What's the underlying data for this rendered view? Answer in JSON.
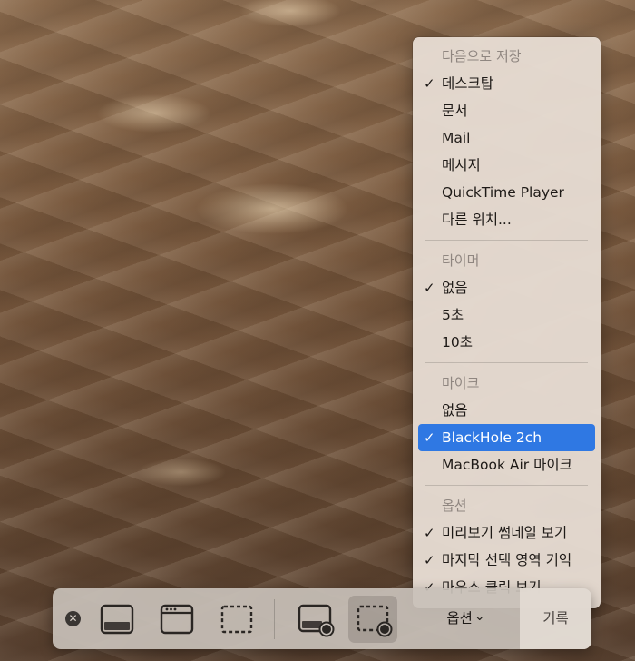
{
  "menu": {
    "save_to": {
      "header": "다음으로 저장",
      "items": [
        {
          "label": "데스크탑",
          "checked": true
        },
        {
          "label": "문서",
          "checked": false
        },
        {
          "label": "Mail",
          "checked": false
        },
        {
          "label": "메시지",
          "checked": false
        },
        {
          "label": "QuickTime Player",
          "checked": false
        },
        {
          "label": "다른 위치...",
          "checked": false
        }
      ]
    },
    "timer": {
      "header": "타이머",
      "items": [
        {
          "label": "없음",
          "checked": true
        },
        {
          "label": "5초",
          "checked": false
        },
        {
          "label": "10초",
          "checked": false
        }
      ]
    },
    "microphone": {
      "header": "마이크",
      "items": [
        {
          "label": "없음",
          "checked": false
        },
        {
          "label": "BlackHole 2ch",
          "checked": true,
          "highlighted": true
        },
        {
          "label": "MacBook Air 마이크",
          "checked": false
        }
      ]
    },
    "options": {
      "header": "옵션",
      "items": [
        {
          "label": "미리보기 썸네일 보기",
          "checked": true
        },
        {
          "label": "마지막 선택 영역 기억",
          "checked": true
        },
        {
          "label": "마우스 클릭 보기",
          "checked": true
        }
      ]
    },
    "check_glyph": "✓"
  },
  "toolbar": {
    "close_glyph": "✕",
    "options_label": "옵션",
    "options_chevron": "⌄",
    "record_label": "기록",
    "accent_color": "#2f78e3"
  }
}
